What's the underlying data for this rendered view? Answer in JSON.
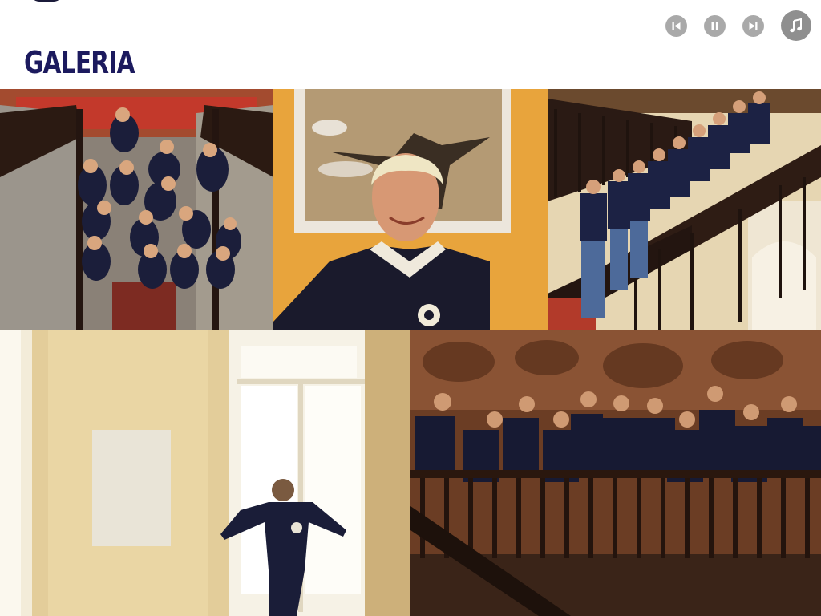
{
  "header": {
    "title": "GALERIA"
  },
  "player": {
    "controls": [
      {
        "name": "previous",
        "icon": "skip-previous-icon"
      },
      {
        "name": "pause",
        "icon": "pause-icon"
      },
      {
        "name": "next",
        "icon": "skip-next-icon"
      },
      {
        "name": "music",
        "icon": "music-note-icon"
      }
    ],
    "button_color": "#a9a9a9"
  },
  "gallery": {
    "photos": [
      {
        "id": "group-on-staircase-from-above"
      },
      {
        "id": "smiling-student-portrait"
      },
      {
        "id": "students-on-grand-staircase"
      },
      {
        "id": "student-arms-open-at-window"
      },
      {
        "id": "students-at-balcony-railing"
      }
    ]
  },
  "colors": {
    "title": "#1c1a5e",
    "background": "#ffffff"
  }
}
